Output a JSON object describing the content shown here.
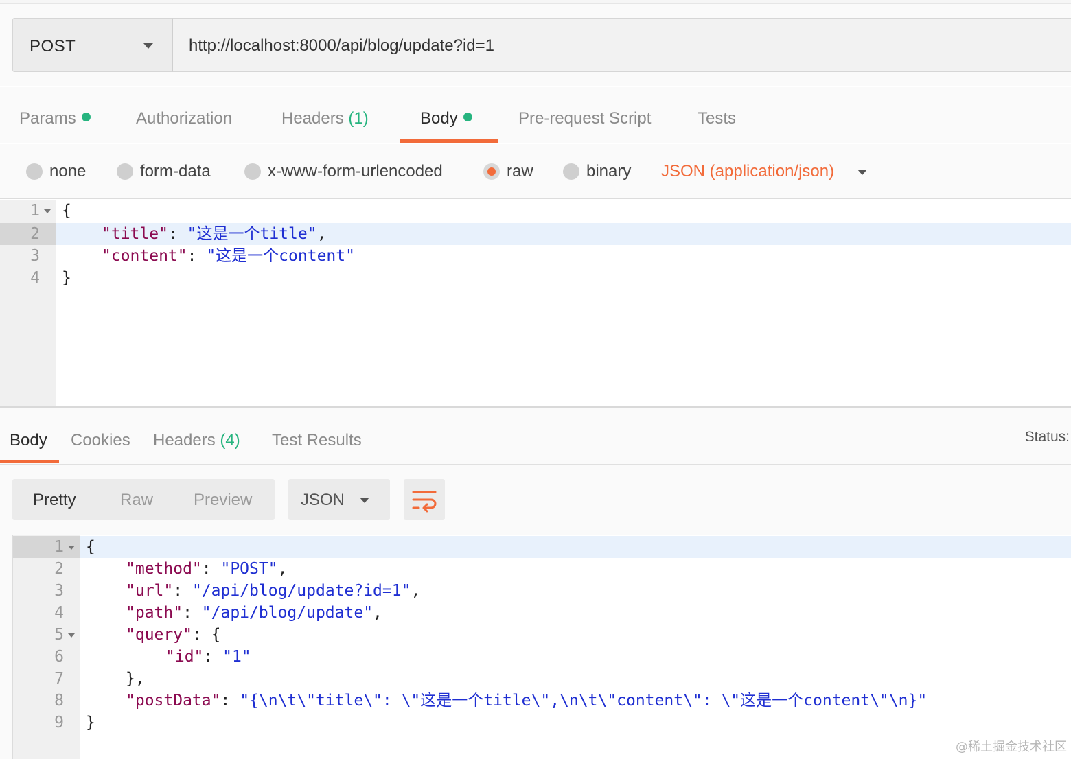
{
  "request": {
    "method": "POST",
    "url": "http://localhost:8000/api/blog/update?id=1"
  },
  "request_tabs": [
    {
      "label": "Params",
      "dot": true
    },
    {
      "label": "Authorization"
    },
    {
      "label": "Headers",
      "count": "(1)"
    },
    {
      "label": "Body",
      "dot": true,
      "active": true
    },
    {
      "label": "Pre-request Script"
    },
    {
      "label": "Tests"
    }
  ],
  "body_types": {
    "options": [
      "none",
      "form-data",
      "x-www-form-urlencoded",
      "raw",
      "binary"
    ],
    "selected": "raw",
    "content_type": "JSON (application/json)"
  },
  "request_body": {
    "line_numbers": [
      "1",
      "2",
      "3",
      "4"
    ],
    "open_brace": "{",
    "title_key": "\"title\"",
    "title_value": "\"这是一个title\"",
    "content_key": "\"content\"",
    "content_value": "\"这是一个content\"",
    "close_brace": "}"
  },
  "response_tabs": [
    {
      "label": "Body",
      "active": true
    },
    {
      "label": "Cookies"
    },
    {
      "label": "Headers",
      "count": "(4)"
    },
    {
      "label": "Test Results"
    }
  ],
  "status_label": "Status:",
  "response_view": {
    "modes": [
      "Pretty",
      "Raw",
      "Preview"
    ],
    "active_mode": "Pretty",
    "format": "JSON",
    "wrap_icon": "wrap-lines-icon"
  },
  "response_body": {
    "line_numbers": [
      "1",
      "2",
      "3",
      "4",
      "5",
      "6",
      "7",
      "8",
      "9"
    ],
    "open_brace": "{",
    "method_key": "\"method\"",
    "method_value": "\"POST\"",
    "url_key": "\"url\"",
    "url_value": "\"/api/blog/update?id=1\"",
    "path_key": "\"path\"",
    "path_value": "\"/api/blog/update\"",
    "query_key": "\"query\"",
    "id_key": "\"id\"",
    "id_value": "\"1\"",
    "query_close": "},",
    "postdata_key": "\"postData\"",
    "postdata_value": "\"{\\n\\t\\\"title\\\": \\\"这是一个title\\\",\\n\\t\\\"content\\\": \\\"这是一个content\\\"\\n}\"",
    "close_brace": "}"
  },
  "watermark": "@稀土掘金技术社区",
  "colors": {
    "accent": "#f26b3a",
    "green": "#26b47f",
    "json_key": "#8b0a50",
    "json_string": "#1f2fd2"
  }
}
